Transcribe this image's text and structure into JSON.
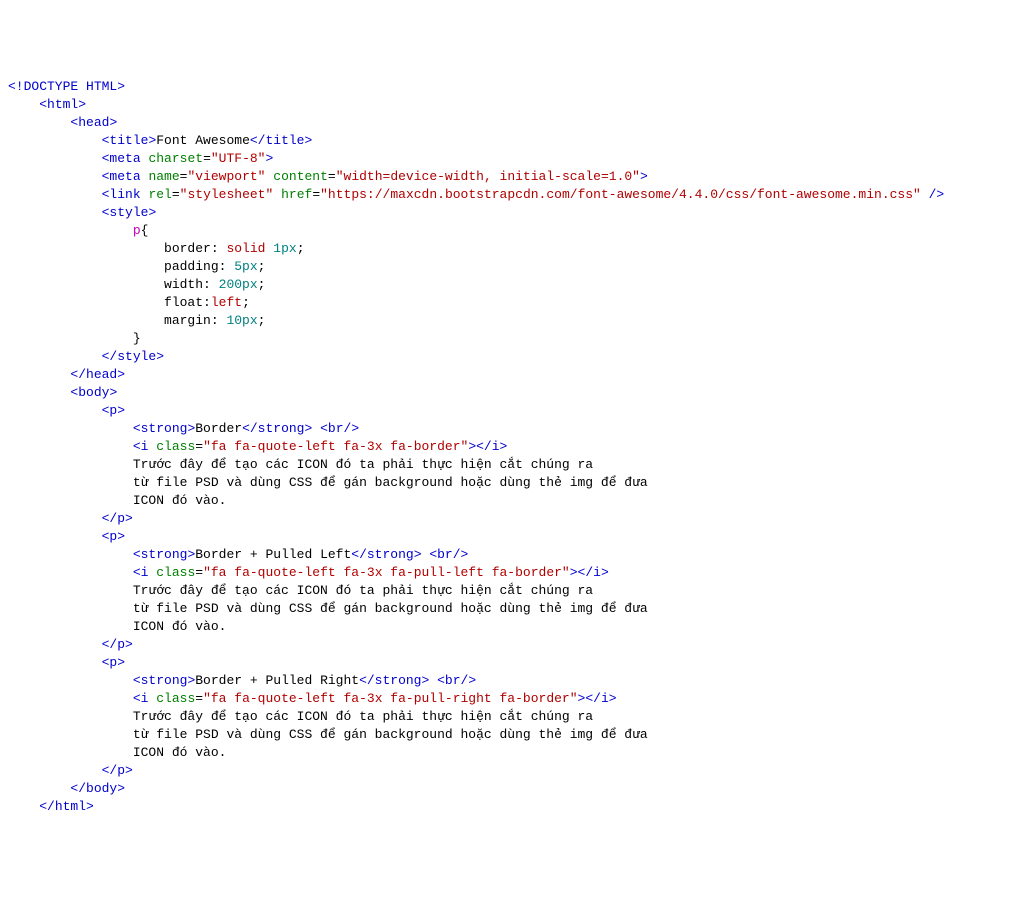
{
  "ln": {
    "l1_a": "<!DOCTYPE HTML",
    "l1_b": ">",
    "l2_a": "<html",
    "l2_b": ">",
    "l3_a": "<head",
    "l3_b": ">",
    "l4_a": "<title",
    "l4_b": ">",
    "l4_c": "Font Awesome",
    "l4_d": "</title",
    "l4_e": ">",
    "l5_a": "<meta",
    "l5_b": " charset",
    "l5_c": "=",
    "l5_d": "\"UTF-8\"",
    "l5_e": ">",
    "l6_a": "<meta",
    "l6_b": " name",
    "l6_c": "=",
    "l6_d": "\"viewport\"",
    "l6_e": " content",
    "l6_f": "=",
    "l6_g": "\"width=device-width, initial-scale=1.0\"",
    "l6_h": ">",
    "l7_a": "<link",
    "l7_b": " rel",
    "l7_c": "=",
    "l7_d": "\"stylesheet\"",
    "l7_e": " href",
    "l7_f": "=",
    "l7_g": "\"https://maxcdn.bootstrapcdn.com/font-awesome/4.4.0/css/font-awesome.min.css\"",
    "l7_h": " />",
    "l8_a": "<style",
    "l8_b": ">",
    "l9_a": "p",
    "l9_b": "{",
    "l10_a": "border",
    "l10_b": ": ",
    "l10_c": "solid",
    "l10_d": " ",
    "l10_e": "1px",
    "l10_f": ";",
    "l11_a": "padding",
    "l11_b": ": ",
    "l11_c": "5px",
    "l11_d": ";",
    "l12_a": "width",
    "l12_b": ": ",
    "l12_c": "200px",
    "l12_d": ";",
    "l13_a": "float",
    "l13_b": ":",
    "l13_c": "left",
    "l13_d": ";",
    "l14_a": "margin",
    "l14_b": ": ",
    "l14_c": "10px",
    "l14_d": ";",
    "l15_a": "}",
    "l16_a": "</style",
    "l16_b": ">",
    "l17_a": "</head",
    "l17_b": ">",
    "l18_a": "<body",
    "l18_b": ">",
    "l19_a": "<p",
    "l19_b": ">",
    "l20_a": "<strong",
    "l20_b": ">",
    "l20_c": "Border",
    "l20_d": "</strong",
    "l20_e": ">",
    "l20_f": " ",
    "l20_g": "<br",
    "l20_h": "/>",
    "l21_a": "<i",
    "l21_b": " class",
    "l21_c": "=",
    "l21_d": "\"fa fa-quote-left fa-3x fa-border\"",
    "l21_e": ">",
    "l21_f": "</i",
    "l21_g": ">",
    "l22_a": "Trước đây để tạo các ICON đó ta phải thực hiện cắt chúng ra",
    "l23_a": "từ file PSD và dùng CSS để gán background hoặc dùng thẻ img để đưa",
    "l24_a": "ICON đó vào.",
    "l25_a": "</p",
    "l25_b": ">",
    "l26_a": "<p",
    "l26_b": ">",
    "l27_a": "<strong",
    "l27_b": ">",
    "l27_c": "Border + Pulled Left",
    "l27_d": "</strong",
    "l27_e": ">",
    "l27_f": " ",
    "l27_g": "<br",
    "l27_h": "/>",
    "l28_a": "<i",
    "l28_b": " class",
    "l28_c": "=",
    "l28_d": "\"fa fa-quote-left fa-3x fa-pull-left fa-border\"",
    "l28_e": ">",
    "l28_f": "</i",
    "l28_g": ">",
    "l29_a": "Trước đây để tạo các ICON đó ta phải thực hiện cắt chúng ra",
    "l30_a": "từ file PSD và dùng CSS để gán background hoặc dùng thẻ img để đưa",
    "l31_a": "ICON đó vào.",
    "l32_a": "</p",
    "l32_b": ">",
    "l33_a": "<p",
    "l33_b": ">",
    "l34_a": "<strong",
    "l34_b": ">",
    "l34_c": "Border + Pulled Right",
    "l34_d": "</strong",
    "l34_e": ">",
    "l34_f": " ",
    "l34_g": "<br",
    "l34_h": "/>",
    "l35_a": "<i",
    "l35_b": " class",
    "l35_c": "=",
    "l35_d": "\"fa fa-quote-left fa-3x fa-pull-right fa-border\"",
    "l35_e": ">",
    "l35_f": "</i",
    "l35_g": ">",
    "l36_a": "Trước đây để tạo các ICON đó ta phải thực hiện cắt chúng ra",
    "l37_a": "từ file PSD và dùng CSS để gán background hoặc dùng thẻ img để đưa",
    "l38_a": "ICON đó vào.",
    "l39_a": "</p",
    "l39_b": ">",
    "l40_a": "</body",
    "l40_b": ">",
    "l41_a": "</html",
    "l41_b": ">"
  }
}
